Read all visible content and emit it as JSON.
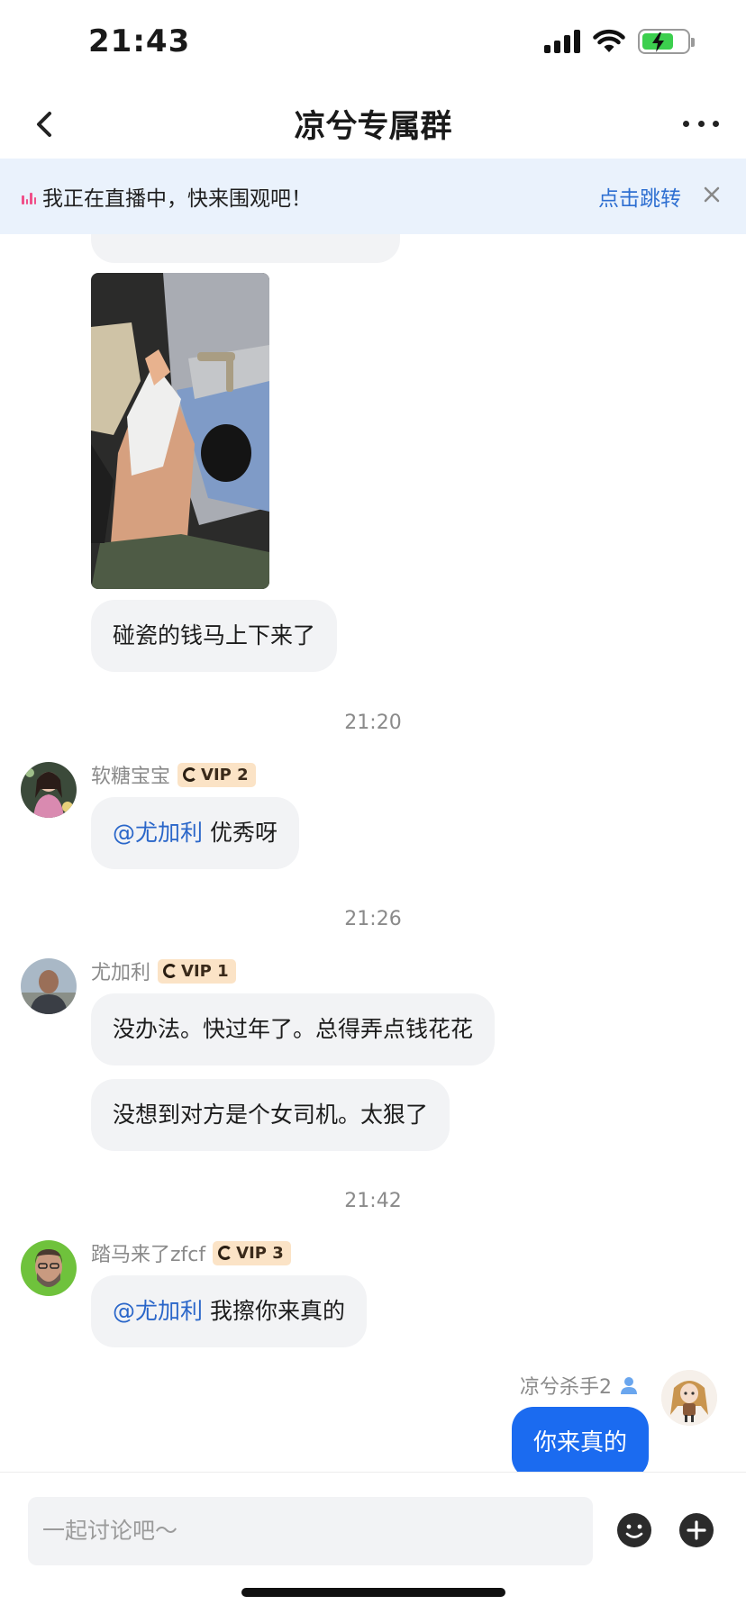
{
  "status_bar": {
    "time": "21:43"
  },
  "nav": {
    "title": "凉兮专属群"
  },
  "banner": {
    "text": "我正在直播中，快来围观吧！",
    "link": "点击跳转"
  },
  "messages": [
    {
      "type": "text",
      "text": "碰瓷的钱马上下来了"
    },
    {
      "type": "time",
      "text": "21:20"
    },
    {
      "sender": "软糖宝宝",
      "vip": "VIP 2",
      "mention": "@尤加利",
      "text": "优秀呀"
    },
    {
      "type": "time",
      "text": "21:26"
    },
    {
      "sender": "尤加利",
      "vip": "VIP 1",
      "texts": [
        "没办法。快过年了。总得弄点钱花花",
        "没想到对方是个女司机。太狠了"
      ]
    },
    {
      "type": "time",
      "text": "21:42"
    },
    {
      "sender": "踏马来了zfcf",
      "vip": "VIP 3",
      "mention": "@尤加利",
      "text": "我擦你来真的"
    }
  ],
  "self": {
    "name": "凉兮杀手2",
    "text": "你来真的"
  },
  "input": {
    "placeholder": "一起讨论吧～"
  },
  "colors": {
    "accent": "#1b6bf0",
    "link": "#2a66c9",
    "banner_bg": "#eaf2fc",
    "vip_bg": "#fbe3c6"
  }
}
